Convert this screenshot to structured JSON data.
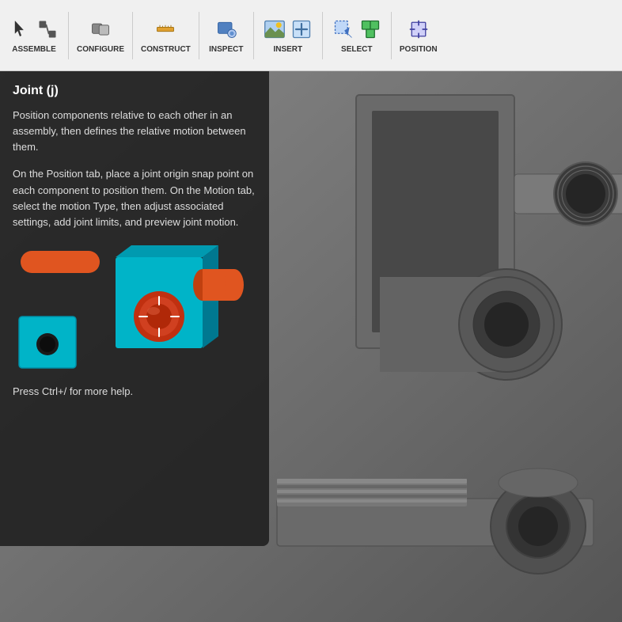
{
  "toolbar": {
    "groups": [
      {
        "id": "assemble",
        "label": "ASSEMBLE",
        "hasArrow": true
      },
      {
        "id": "configure",
        "label": "CONFIGURE",
        "hasArrow": true
      },
      {
        "id": "construct",
        "label": "CONSTRUCT",
        "hasArrow": true
      },
      {
        "id": "inspect",
        "label": "INSPECT",
        "hasArrow": true
      },
      {
        "id": "insert",
        "label": "INSERT",
        "hasArrow": true
      },
      {
        "id": "select",
        "label": "SELECT",
        "hasArrow": true
      },
      {
        "id": "position",
        "label": "POSITION",
        "hasArrow": true
      }
    ]
  },
  "help_panel": {
    "title": "Joint (j)",
    "description1": "Position components relative to each other in an assembly, then defines the relative motion between them.",
    "description2": "On the Position tab, place a joint origin snap point on each component to position them. On the Motion tab, select the motion Type, then adjust associated settings, add joint limits, and preview joint motion.",
    "ctrl_hint": "Press Ctrl+/ for more help."
  }
}
